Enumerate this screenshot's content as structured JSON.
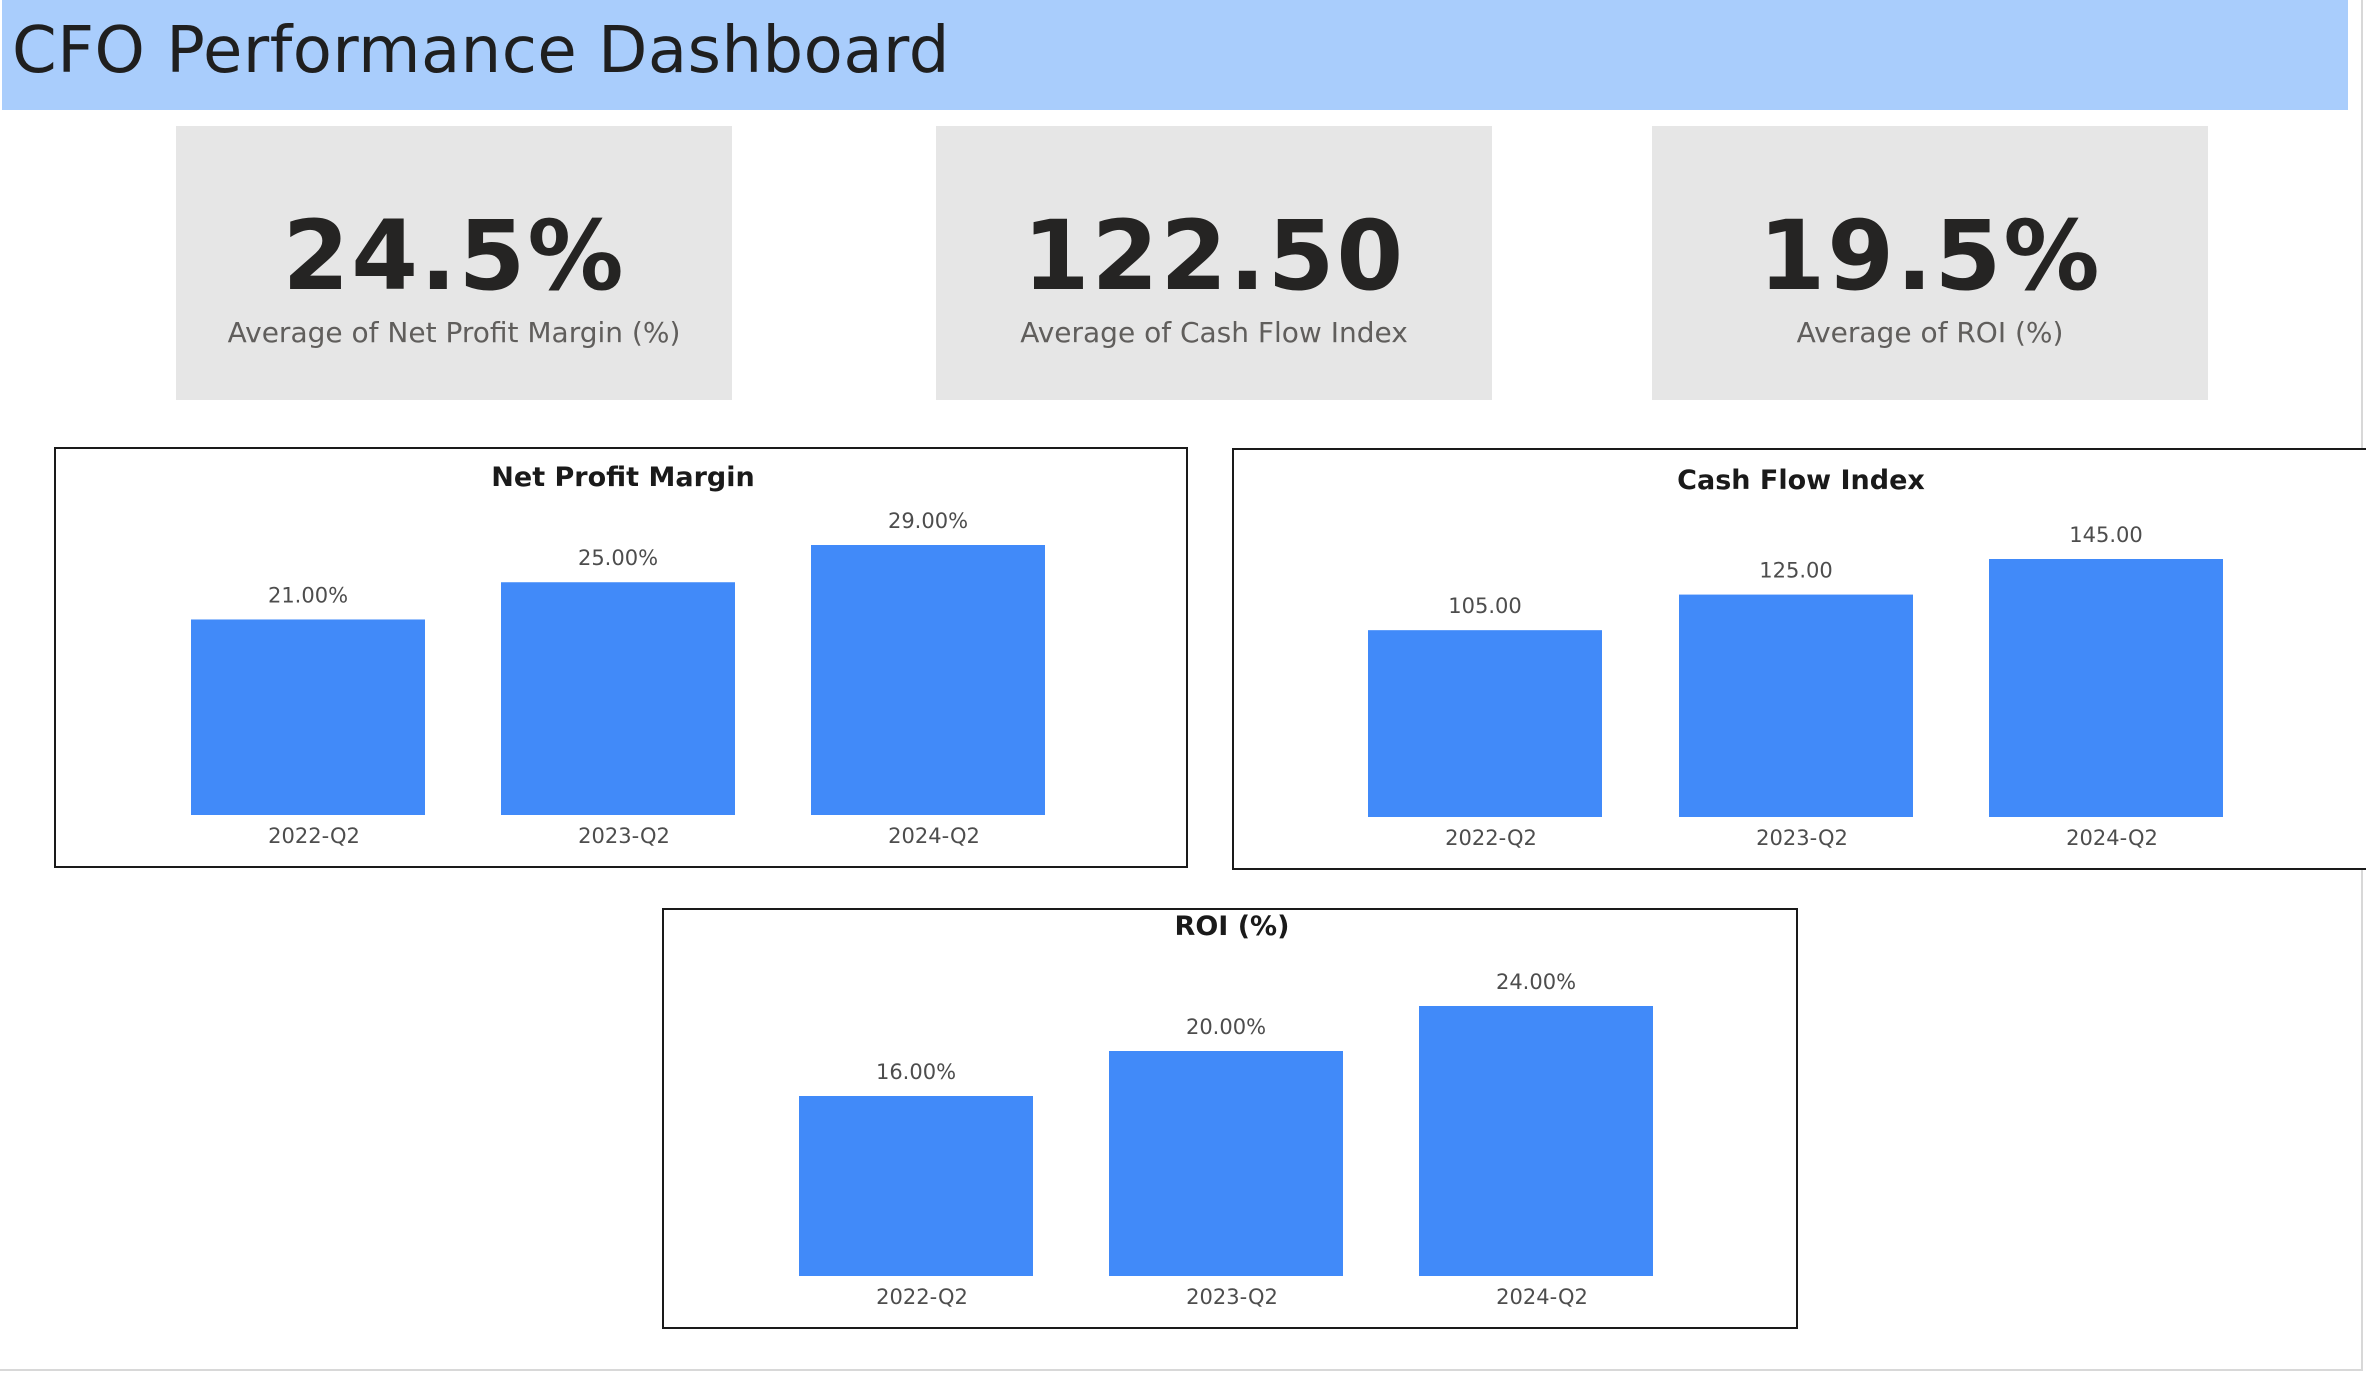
{
  "header": {
    "title": "CFO Performance Dashboard",
    "background_color": "#a9cdfc"
  },
  "kpis": [
    {
      "value": "24.5%",
      "label": "Average of Net Profit Margin (%)"
    },
    {
      "value": "122.50",
      "label": "Average of Cash Flow Index"
    },
    {
      "value": "19.5%",
      "label": "Average of ROI (%)"
    }
  ],
  "colors": {
    "bar": "#418af9",
    "kpi_card": "#e6e6e6"
  },
  "chart_data": [
    {
      "type": "bar",
      "title": "Net Profit Margin",
      "categories": [
        "2022-Q2",
        "2023-Q2",
        "2024-Q2"
      ],
      "values": [
        21.0,
        25.0,
        29.0
      ],
      "data_labels": [
        "21.00%",
        "25.00%",
        "29.00%"
      ],
      "ylim": [
        0,
        29
      ],
      "xlabel": "",
      "ylabel": "",
      "grid": false,
      "bar_color": "#418af9"
    },
    {
      "type": "bar",
      "title": "Cash Flow Index",
      "categories": [
        "2022-Q2",
        "2023-Q2",
        "2024-Q2"
      ],
      "values": [
        105.0,
        125.0,
        145.0
      ],
      "data_labels": [
        "105.00",
        "125.00",
        "145.00"
      ],
      "ylim": [
        0,
        145
      ],
      "xlabel": "",
      "ylabel": "",
      "grid": false,
      "bar_color": "#418af9"
    },
    {
      "type": "bar",
      "title": "ROI (%)",
      "categories": [
        "2022-Q2",
        "2023-Q2",
        "2024-Q2"
      ],
      "values": [
        16.0,
        20.0,
        24.0
      ],
      "data_labels": [
        "16.00%",
        "20.00%",
        "24.00%"
      ],
      "ylim": [
        0,
        24
      ],
      "xlabel": "",
      "ylabel": "",
      "grid": false,
      "bar_color": "#418af9"
    }
  ]
}
